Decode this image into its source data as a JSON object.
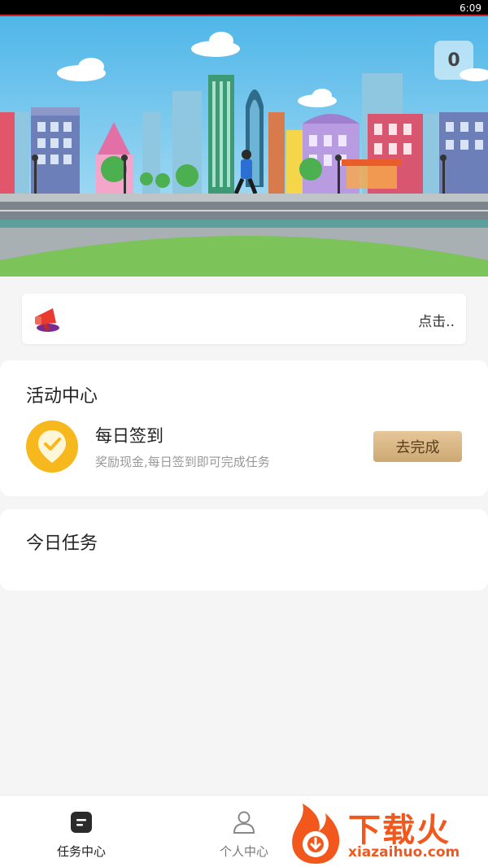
{
  "status_bar": {
    "time": "6:09"
  },
  "banner": {
    "coin_count": "0"
  },
  "notice": {
    "text": "点击.."
  },
  "activity_center": {
    "title": "活动中心",
    "task": {
      "name": "每日签到",
      "description": "奖励现金,每日签到即可完成任务",
      "button_label": "去完成"
    }
  },
  "today_tasks": {
    "title": "今日任务"
  },
  "tab_bar": {
    "tabs": [
      {
        "label": "任务中心",
        "icon": "task-list-icon",
        "active": true
      },
      {
        "label": "个人中心",
        "icon": "person-icon",
        "active": false
      }
    ]
  },
  "watermark": {
    "brand": "下载火",
    "url": "xiazaihuo.com"
  },
  "colors": {
    "accent_gold": "#cda874",
    "icon_yellow": "#f6b81c",
    "watermark_orange": "#f2581c",
    "status_line": "#e02020"
  }
}
